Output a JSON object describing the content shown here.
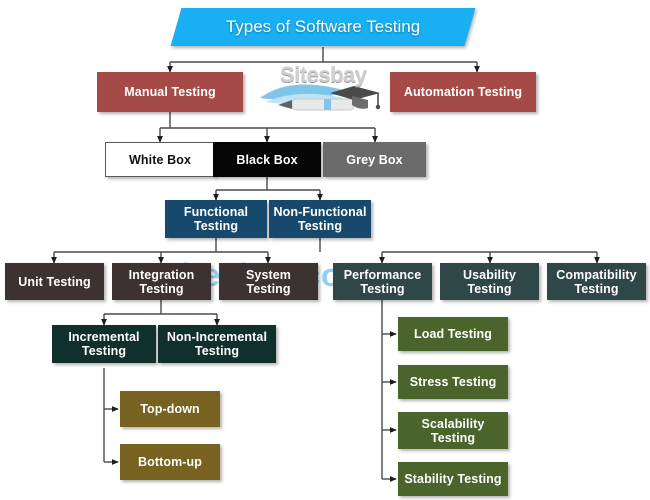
{
  "diagram": {
    "title": "Types of Software Testing",
    "watermark_text": "Sitesbay.com",
    "logo_word": "Sitesbay",
    "colors": {
      "title": "#18b0f2",
      "red": "#a54a46",
      "white_box": "#ffffff",
      "black_box": "#050505",
      "grey_box": "#6b6b6b",
      "navy": "#17496c",
      "brown": "#3b3231",
      "slate": "#2f4746",
      "dark_teal": "#10302b",
      "olive": "#77621f",
      "green": "#4a642c",
      "connector": "#4a4a4a",
      "watermark": "#7ec8f5"
    },
    "nodes": {
      "manual_testing": "Manual Testing",
      "automation_testing": "Automation Testing",
      "white_box": "White Box",
      "black_box": "Black Box",
      "grey_box": "Grey Box",
      "functional_testing": "Functional Testing",
      "non_functional_testing": "Non-Functional Testing",
      "unit_testing": "Unit Testing",
      "integration_testing": "Integration Testing",
      "system_testing": "System Testing",
      "performance_testing": "Performance Testing",
      "usability_testing": "Usability Testing",
      "compatibility_testing": "Compatibility Testing",
      "incremental_testing": "Incremental Testing",
      "non_incremental_testing": "Non-Incremental Testing",
      "top_down": "Top-down",
      "bottom_up": "Bottom-up",
      "load_testing": "Load Testing",
      "stress_testing": "Stress Testing",
      "scalability_testing": "Scalability Testing",
      "stability_testing": "Stability Testing"
    }
  }
}
